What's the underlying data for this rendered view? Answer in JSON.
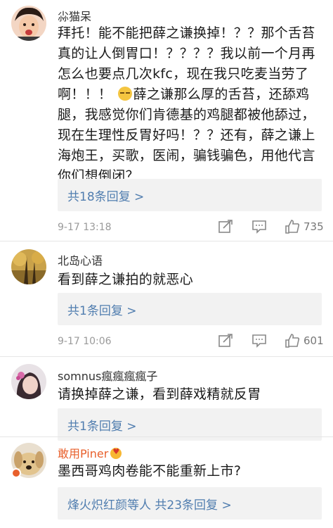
{
  "comments": [
    {
      "username": "尛猫呆",
      "text": "拜托！能不能把薛之谦换掉！？？那个舌苔真的让人倒胃口！？？？？我以前一个月再怎么也要点几次kfc，现在我只吃麦当劳了啊！！！",
      "text2": "薛之谦那么厚的舌苔，还舔鸡腿，我感觉你们肯德基的鸡腿都被他舔过，现在生理性反胃好吗！？？还有，薛之谦上海炮王，买歌，医闹，骗钱骗色，用他代言你们想倒闭？",
      "reply_label": "共18条回复 >",
      "timestamp": "9-17 13:18",
      "likes": "735"
    },
    {
      "username": "北岛心语",
      "text": "看到薛之谦拍的就恶心",
      "reply_label": "共1条回复 >",
      "timestamp": "9-17 10:06",
      "likes": "601"
    },
    {
      "username": "somnus瘋瘋瘋瘋子",
      "text": "请换掉薛之谦，看到薛戏精就反胃",
      "reply_label": "共1条回复 >"
    },
    {
      "username": "敢用Piner",
      "text": "墨西哥鸡肉卷能不能重新上市?",
      "reply_label": "烽火炽红颜等人 共23条回复 >"
    }
  ],
  "icons": {
    "share": "share-edit-icon",
    "comment": "comment-icon",
    "like": "thumbs-up-icon"
  },
  "colors": {
    "link": "#507daf",
    "vip_name": "#e8602c",
    "reply_bg": "#f2f2f2"
  }
}
